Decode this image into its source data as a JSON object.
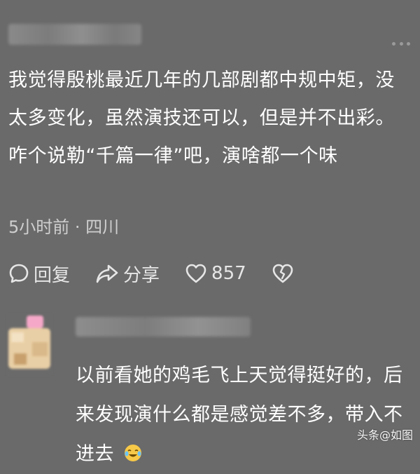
{
  "comment": {
    "text": "我觉得殷桃最近几年的几部剧都中规中矩，没太多变化，虽然演技还可以，但是并不出彩。咋个说勒“千篇一律”吧，演啥都一个味",
    "meta": "5小时前 · 四川",
    "actions": {
      "reply_label": "回复",
      "share_label": "分享",
      "like_count": "857"
    }
  },
  "reply": {
    "text": "以前看她的鸡毛飞上天觉得挺好的，后来发现演什么都是感觉差不多，带入不进去"
  },
  "watermark": "头条@如图",
  "icons": {
    "more": "more-dots-icon",
    "reply": "comment-bubble-icon",
    "share": "share-arrow-icon",
    "like": "heart-icon",
    "dislike": "broken-heart-icon",
    "emoji": "laughing-tears-emoji"
  }
}
